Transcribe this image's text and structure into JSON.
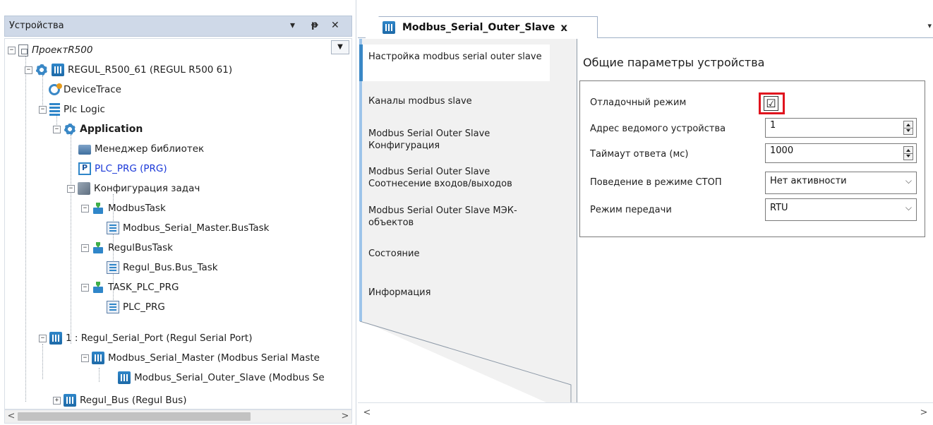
{
  "devices_panel": {
    "title": "Устройства",
    "pin_glyph": "ᵽ",
    "dropdown_glyph": "▾",
    "close_glyph": "✕",
    "scroll_left": "<",
    "scroll_right": ">"
  },
  "tree": {
    "project": "ПроектR500",
    "device": "REGUL_R500_61 (REGUL R500 61)",
    "devicetrace": "DeviceTrace",
    "plc_logic": "Plc Logic",
    "application": "Application",
    "library_manager": "Менеджер библиотек",
    "plc_prg": "PLC_PRG (PRG)",
    "task_config": "Конфигурация задач",
    "modbus_task": "ModbusTask",
    "modbus_bustask": "Modbus_Serial_Master.BusTask",
    "regulbus_task": "RegulBusTask",
    "regul_bus_task": "Regul_Bus.Bus_Task",
    "task_plc_prg": "TASK_PLC_PRG",
    "plc_prg_call": "PLC_PRG",
    "serial_port": "1 : Regul_Serial_Port (Regul Serial Port)",
    "modbus_master": "Modbus_Serial_Master (Modbus Serial Maste",
    "modbus_outer_slave": "Modbus_Serial_Outer_Slave (Modbus Se",
    "regul_bus": "Regul_Bus (Regul Bus)"
  },
  "editor": {
    "tab_title": "Modbus_Serial_Outer_Slave",
    "tab_close": "x",
    "tab_menu": "▾",
    "nav": [
      "Настройка modbus serial outer slave",
      "Каналы modbus slave",
      "Modbus Serial Outer Slave Конфигурация",
      "Modbus Serial Outer Slave Соотнесение входов/выходов",
      "Modbus Serial Outer Slave МЭК-объектов",
      "Состояние",
      "Информация"
    ],
    "section_title": "Общие параметры устройства",
    "params": {
      "debug_label": "Отладочный режим",
      "debug_checked": "☑",
      "slave_address_label": "Адрес ведомого устройства",
      "slave_address_value": "1",
      "timeout_label": "Таймаут ответа (мс)",
      "timeout_value": "1000",
      "stop_behavior_label": "Поведение в режиме СТОП",
      "stop_behavior_value": "Нет активности",
      "transfer_mode_label": "Режим передачи",
      "transfer_mode_value": "RTU",
      "select_arrow": "⌵"
    },
    "scroll_left": "<",
    "scroll_right": ">"
  },
  "colors": {
    "accent_blue": "#3a88c6",
    "highlight_red": "#e0141e",
    "header_bg": "#cfd9e8",
    "link_blue": "#1a38d8"
  }
}
